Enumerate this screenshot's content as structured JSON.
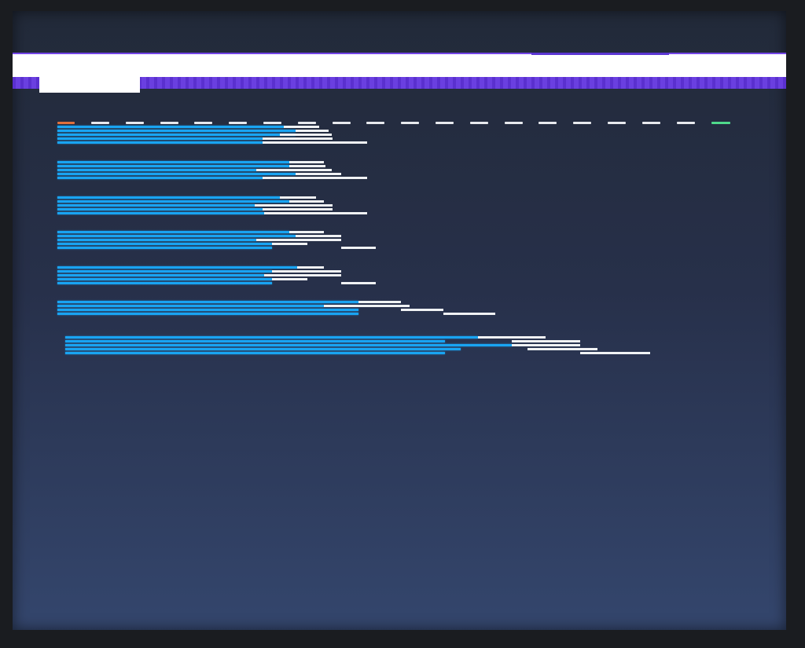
{
  "screen": {
    "background_top": "#222a39",
    "background_bottom": "#34466d"
  },
  "colors": {
    "accent_purple": "#6a3fe0",
    "bar_blue": "#19a4f2",
    "bar_white": "#f0f2f4",
    "bar_red": "#b2423a",
    "start_orange": "#e0703c",
    "end_green": "#4fd98b"
  }
}
